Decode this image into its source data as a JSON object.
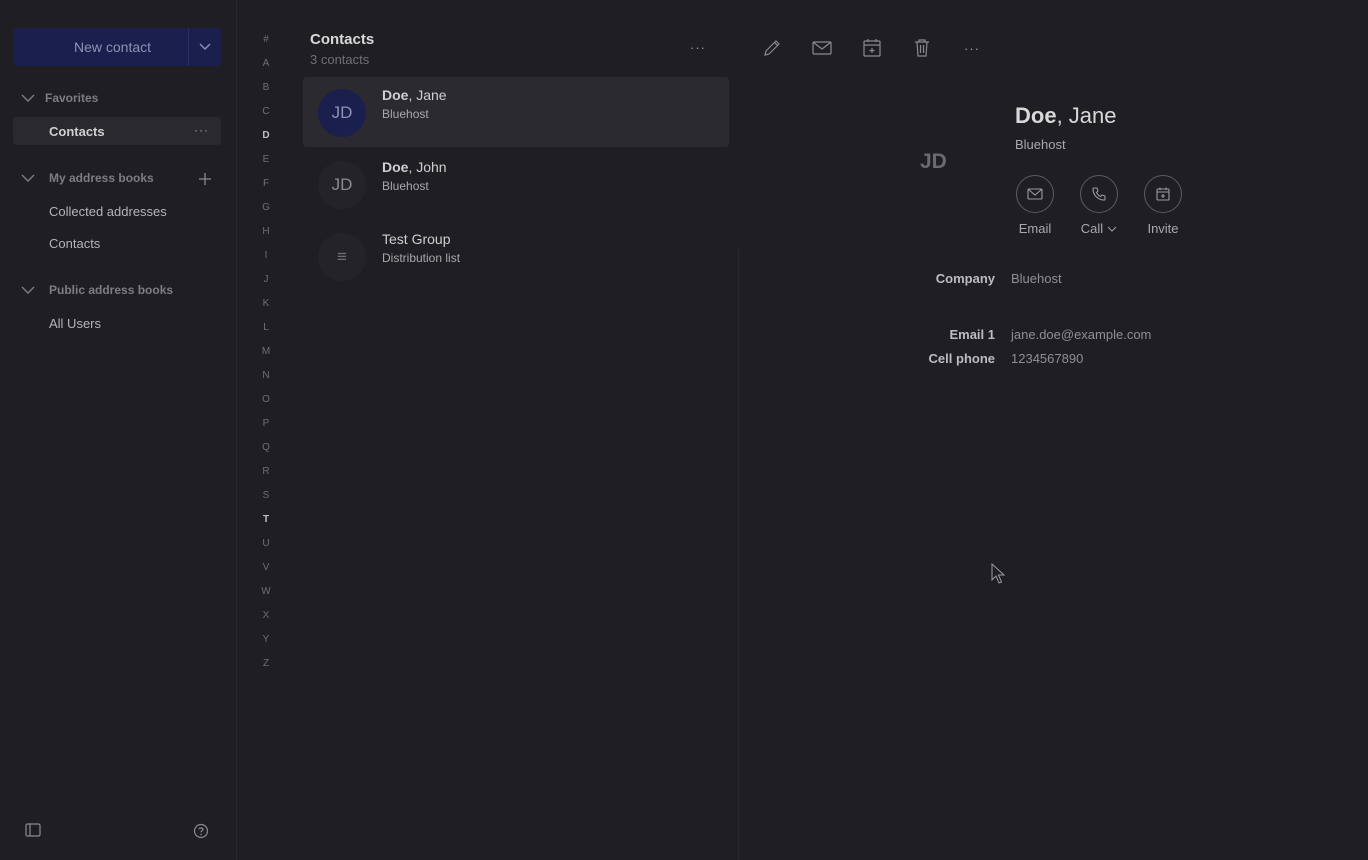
{
  "sidebar": {
    "new_contact_label": "New contact",
    "favorites": {
      "title": "Favorites",
      "items": [
        {
          "label": "Contacts"
        }
      ]
    },
    "my_address_books": {
      "title": "My address books",
      "items": [
        {
          "label": "Collected addresses"
        },
        {
          "label": "Contacts"
        }
      ]
    },
    "public_address_books": {
      "title": "Public address books",
      "items": [
        {
          "label": "All Users"
        }
      ]
    }
  },
  "alpha_index": [
    "#",
    "A",
    "B",
    "C",
    "D",
    "E",
    "F",
    "G",
    "H",
    "I",
    "J",
    "K",
    "L",
    "M",
    "N",
    "O",
    "P",
    "Q",
    "R",
    "S",
    "T",
    "U",
    "V",
    "W",
    "X",
    "Y",
    "Z"
  ],
  "alpha_bold": [
    "D",
    "T"
  ],
  "list": {
    "title": "Contacts",
    "count": "3 contacts",
    "rows": [
      {
        "initials": "JD",
        "last": "Doe",
        "first": ", Jane",
        "sub": "Bluehost",
        "selected": true
      },
      {
        "initials": "JD",
        "last": "Doe",
        "first": ", John",
        "sub": "Bluehost",
        "selected": false
      },
      {
        "initials": "≡",
        "last": "",
        "first": "Test Group",
        "sub": "Distribution list",
        "selected": false
      }
    ]
  },
  "detail": {
    "initials": "JD",
    "last": "Doe",
    "first": ", Jane",
    "company_sub": "Bluehost",
    "actions": {
      "email": "Email",
      "call": "Call",
      "invite": "Invite"
    },
    "fields": [
      {
        "label": "Company",
        "value": "Bluehost"
      },
      {
        "label": "Email 1",
        "value": "jane.doe@example.com"
      },
      {
        "label": "Cell phone",
        "value": "1234567890"
      }
    ]
  },
  "colors": {
    "accent": "#1a1f4e",
    "background": "#1f1f23",
    "selected_row": "#2a2a30"
  },
  "icons": [
    "chevron-down-icon",
    "plus-icon",
    "more-icon",
    "pencil-icon",
    "mail-icon",
    "calendar-add-icon",
    "trash-icon",
    "phone-icon",
    "panel-toggle-icon",
    "help-icon",
    "cursor-icon"
  ]
}
